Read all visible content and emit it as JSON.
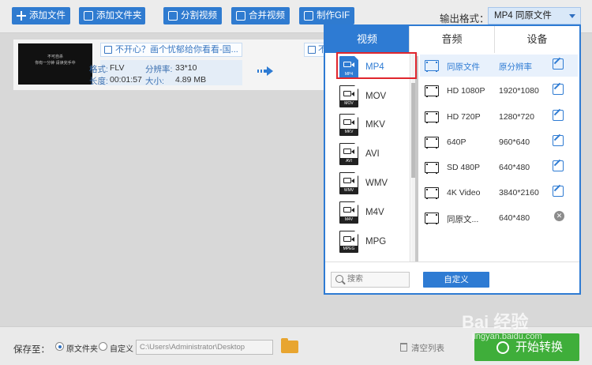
{
  "toolbar": {
    "add_file": "添加文件",
    "add_folder": "添加文件夹",
    "split_video": "分割视频",
    "merge_video": "合并视频",
    "make_gif": "制作GIF",
    "output_format_label": "输出格式：",
    "output_format_value": "MP4  同原文件"
  },
  "file": {
    "thumb_line1": "不可自杀",
    "thumb_line2": "你有一分钟 请读完手中",
    "name": "不开心？画个忧郁给你看看-国...",
    "name_out": "不",
    "format_label": "格式:",
    "format_value": "FLV",
    "resolution_label": "分辨率:",
    "resolution_value": "33*10",
    "duration_label": "长度:",
    "duration_value": "00:01:57",
    "size_label": "大小:",
    "size_value": "4.89 MB"
  },
  "panel": {
    "tabs": [
      {
        "label": "视频",
        "active": true
      },
      {
        "label": "音频",
        "active": false
      },
      {
        "label": "设备",
        "active": false
      }
    ],
    "formats": [
      {
        "label": "MP4",
        "tag": "MP4",
        "selected": true
      },
      {
        "label": "MOV",
        "tag": "MOV",
        "selected": false
      },
      {
        "label": "MKV",
        "tag": "MKV",
        "selected": false
      },
      {
        "label": "AVI",
        "tag": "AVI",
        "selected": false
      },
      {
        "label": "WMV",
        "tag": "WMV",
        "selected": false
      },
      {
        "label": "M4V",
        "tag": "M4V",
        "selected": false
      },
      {
        "label": "MPG",
        "tag": "MPEG",
        "selected": false
      }
    ],
    "qualities": [
      {
        "name": "同原文件",
        "resolution": "原分辨率",
        "action": "edit",
        "selected": true
      },
      {
        "name": "HD 1080P",
        "resolution": "1920*1080",
        "action": "edit",
        "selected": false
      },
      {
        "name": "HD 720P",
        "resolution": "1280*720",
        "action": "edit",
        "selected": false
      },
      {
        "name": "640P",
        "resolution": "960*640",
        "action": "edit",
        "selected": false
      },
      {
        "name": "SD 480P",
        "resolution": "640*480",
        "action": "edit",
        "selected": false
      },
      {
        "name": "4K Video",
        "resolution": "3840*2160",
        "action": "edit",
        "selected": false
      },
      {
        "name": "同原文...",
        "resolution": "640*480",
        "action": "delete",
        "selected": false
      }
    ],
    "search_placeholder": "搜索",
    "custom_button": "自定义"
  },
  "bottom": {
    "save_to": "保存至：",
    "option_source": "原文件夹",
    "option_custom": "自定义",
    "path": "C:\\Users\\Administrator\\Desktop",
    "clear_list": "清空列表",
    "start": "开始转换"
  },
  "watermark": {
    "brand": "Bai 经验",
    "url": "jingyan.baidu.com"
  },
  "colors": {
    "primary": "#2e7bd3",
    "start_green": "#3fae3a",
    "highlight_red": "#e0262d"
  }
}
